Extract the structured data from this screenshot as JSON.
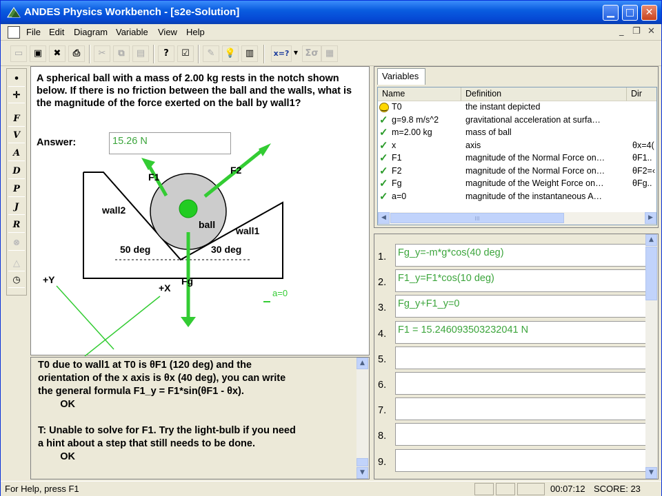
{
  "window": {
    "title": "ANDES Physics Workbench - [s2e-Solution]"
  },
  "menu": [
    "File",
    "Edit",
    "Diagram",
    "Variable",
    "View",
    "Help"
  ],
  "toolbar": {
    "equation_label": "x=?",
    "sum_label": "Σσ"
  },
  "lefttools": [
    "•",
    "✛",
    "F",
    "V",
    "A",
    "D",
    "P",
    "J",
    "R",
    "",
    ""
  ],
  "problem": {
    "text": "A spherical ball with a mass of 2.00 kg rests in the notch shown below.  If there is no friction between the ball and the walls, what is the magnitude of the force exerted on the ball by wall1?",
    "answer_label": "Answer:",
    "answer_value": "15.26 N"
  },
  "diagram": {
    "labels": {
      "f1": "F1",
      "f2": "F2",
      "wall2": "wall2",
      "wall1": "wall1",
      "ball": "ball",
      "deg50": "50 deg",
      "deg30": "30 deg",
      "fg": "Fg",
      "plus_y": "+Y",
      "plus_x": "+X",
      "accel": "a=0"
    },
    "colors": {
      "vector": "#33cc33",
      "ball_fill": "#cccccc",
      "center": "#22cc22"
    }
  },
  "hint": {
    "text": "T0 due to wall1 at T0 is θF1 (120 deg) and the\norientation of the x axis is θx (40 deg), you can write\nthe general formula F1_y = F1*sin(θF1 - θx).\n        OK\n\nT: Unable to solve for F1. Try the light-bulb if you need\na hint about a step that still needs to be done.\n        OK"
  },
  "variables": {
    "tab": "Variables",
    "columns": [
      "Name",
      "Definition",
      "Dir"
    ],
    "rows": [
      {
        "icon": "smiley-icon",
        "name": "T0",
        "def": "the instant depicted",
        "dir": ""
      },
      {
        "icon": "check-icon",
        "name": "g=9.8 m/s^2",
        "def": "gravitational acceleration at surfa…",
        "dir": ""
      },
      {
        "icon": "check-icon",
        "name": "m=2.00 kg",
        "def": "mass of ball",
        "dir": ""
      },
      {
        "icon": "check-icon",
        "name": "x",
        "def": "axis",
        "dir": "θx=4("
      },
      {
        "icon": "check-icon",
        "name": "F1",
        "def": "magnitude of the Normal Force on…",
        "dir": "θF1.."
      },
      {
        "icon": "check-icon",
        "name": "F2",
        "def": "magnitude of the Normal Force on…",
        "dir": "θF2=‹"
      },
      {
        "icon": "check-icon",
        "name": "Fg",
        "def": "magnitude of the Weight Force on…",
        "dir": "θFg.."
      },
      {
        "icon": "check-icon",
        "name": "a=0",
        "def": "magnitude of the instantaneous A…",
        "dir": ""
      }
    ],
    "hscroll_grip": "III"
  },
  "equations": [
    {
      "n": "1.",
      "text": "Fg_y=-m*g*cos(40 deg)"
    },
    {
      "n": "2.",
      "text": "F1_y=F1*cos(10 deg)"
    },
    {
      "n": "3.",
      "text": "Fg_y+F1_y=0"
    },
    {
      "n": "4.",
      "text": "F1 = 15.246093503232041 N"
    },
    {
      "n": "5.",
      "text": ""
    },
    {
      "n": "6.",
      "text": ""
    },
    {
      "n": "7.",
      "text": ""
    },
    {
      "n": "8.",
      "text": ""
    },
    {
      "n": "9.",
      "text": ""
    }
  ],
  "status": {
    "help": "For Help, press F1",
    "time": "00:07:12",
    "score": "SCORE: 23"
  }
}
